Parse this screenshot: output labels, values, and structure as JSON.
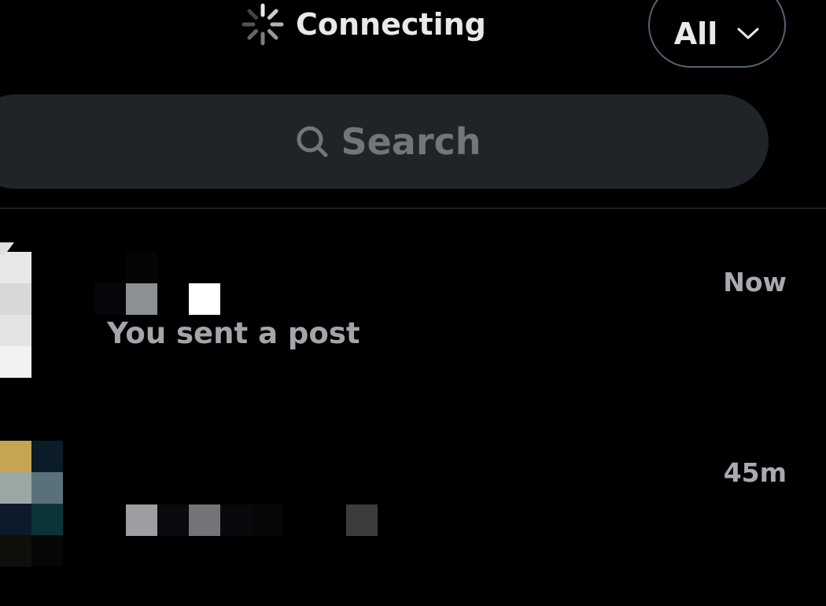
{
  "header": {
    "status_text": "Connecting",
    "status_icon": "loading-spinner-icon",
    "filter": {
      "selected": "All",
      "icon": "chevron-down-icon"
    }
  },
  "search": {
    "placeholder": "Search",
    "icon": "search-icon"
  },
  "conversations": [
    {
      "avatar": "pixelated-avatar",
      "name": "",
      "preview": "You sent a post",
      "time": "Now"
    },
    {
      "avatar": "pixelated-avatar",
      "name": "",
      "preview": "",
      "time": "45m"
    }
  ],
  "colors": {
    "background": "#000000",
    "primary_text": "#e7e9ea",
    "secondary_text": "#71767b",
    "search_bg": "#202327",
    "border": "#536471",
    "divider": "#2f3336"
  }
}
